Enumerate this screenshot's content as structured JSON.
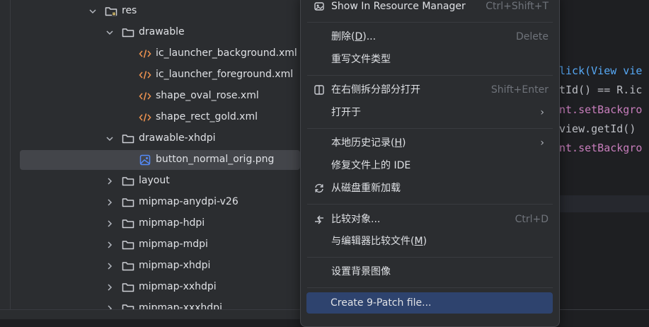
{
  "tree": {
    "rows": [
      {
        "label": "res",
        "kind": "res-folder",
        "chevron": "down"
      },
      {
        "label": "drawable",
        "kind": "folder",
        "chevron": "down"
      },
      {
        "label": "ic_launcher_background.xml",
        "kind": "xml"
      },
      {
        "label": "ic_launcher_foreground.xml",
        "kind": "xml"
      },
      {
        "label": "shape_oval_rose.xml",
        "kind": "xml"
      },
      {
        "label": "shape_rect_gold.xml",
        "kind": "xml"
      },
      {
        "label": "drawable-xhdpi",
        "kind": "folder",
        "chevron": "down"
      },
      {
        "label": "button_normal_orig.png",
        "kind": "png",
        "selected": true
      },
      {
        "label": "layout",
        "kind": "folder",
        "chevron": "right"
      },
      {
        "label": "mipmap-anydpi-v26",
        "kind": "folder",
        "chevron": "right"
      },
      {
        "label": "mipmap-hdpi",
        "kind": "folder",
        "chevron": "right"
      },
      {
        "label": "mipmap-mdpi",
        "kind": "folder",
        "chevron": "right"
      },
      {
        "label": "mipmap-xhdpi",
        "kind": "folder",
        "chevron": "right"
      },
      {
        "label": "mipmap-xxhdpi",
        "kind": "folder",
        "chevron": "right"
      },
      {
        "label": "mipmap-xxxhdpi",
        "kind": "folder",
        "chevron": "right"
      }
    ]
  },
  "editor": {
    "lines": [
      {
        "text": "lick(View vie",
        "color": "#56a8f5"
      },
      {
        "text": "tId() == R.ic",
        "color": "#bcbec4"
      },
      {
        "text": "nt.setBackgro",
        "color": "#c77dbb"
      },
      {
        "text": "view.getId() ",
        "color": "#bcbec4"
      },
      {
        "text": "nt.setBackgro",
        "color": "#c77dbb"
      }
    ]
  },
  "menu": {
    "show_resource_manager": {
      "label": "Show In Resource Manager",
      "shortcut": "Ctrl+Shift+T"
    },
    "delete": {
      "label_pre": "删除(",
      "mnemonic": "D",
      "label_post": ")...",
      "shortcut": "Delete"
    },
    "override_type": {
      "label": "重写文件类型"
    },
    "open_split": {
      "label": "在右侧拆分部分打开",
      "shortcut": "Shift+Enter"
    },
    "open_in": {
      "label": "打开于"
    },
    "local_history": {
      "label_pre": "本地历史记录(",
      "mnemonic": "H",
      "label_post": ")"
    },
    "repair_ide": {
      "label": "修复文件上的 IDE"
    },
    "reload_disk": {
      "label": "从磁盘重新加载"
    },
    "compare_with": {
      "label": "比较对象...",
      "shortcut": "Ctrl+D"
    },
    "compare_editor": {
      "label_pre": "与编辑器比较文件(",
      "mnemonic": "M",
      "label_post": ")"
    },
    "set_background": {
      "label": "设置背景图像"
    },
    "create_9patch": {
      "label": "Create 9-Patch file..."
    }
  }
}
